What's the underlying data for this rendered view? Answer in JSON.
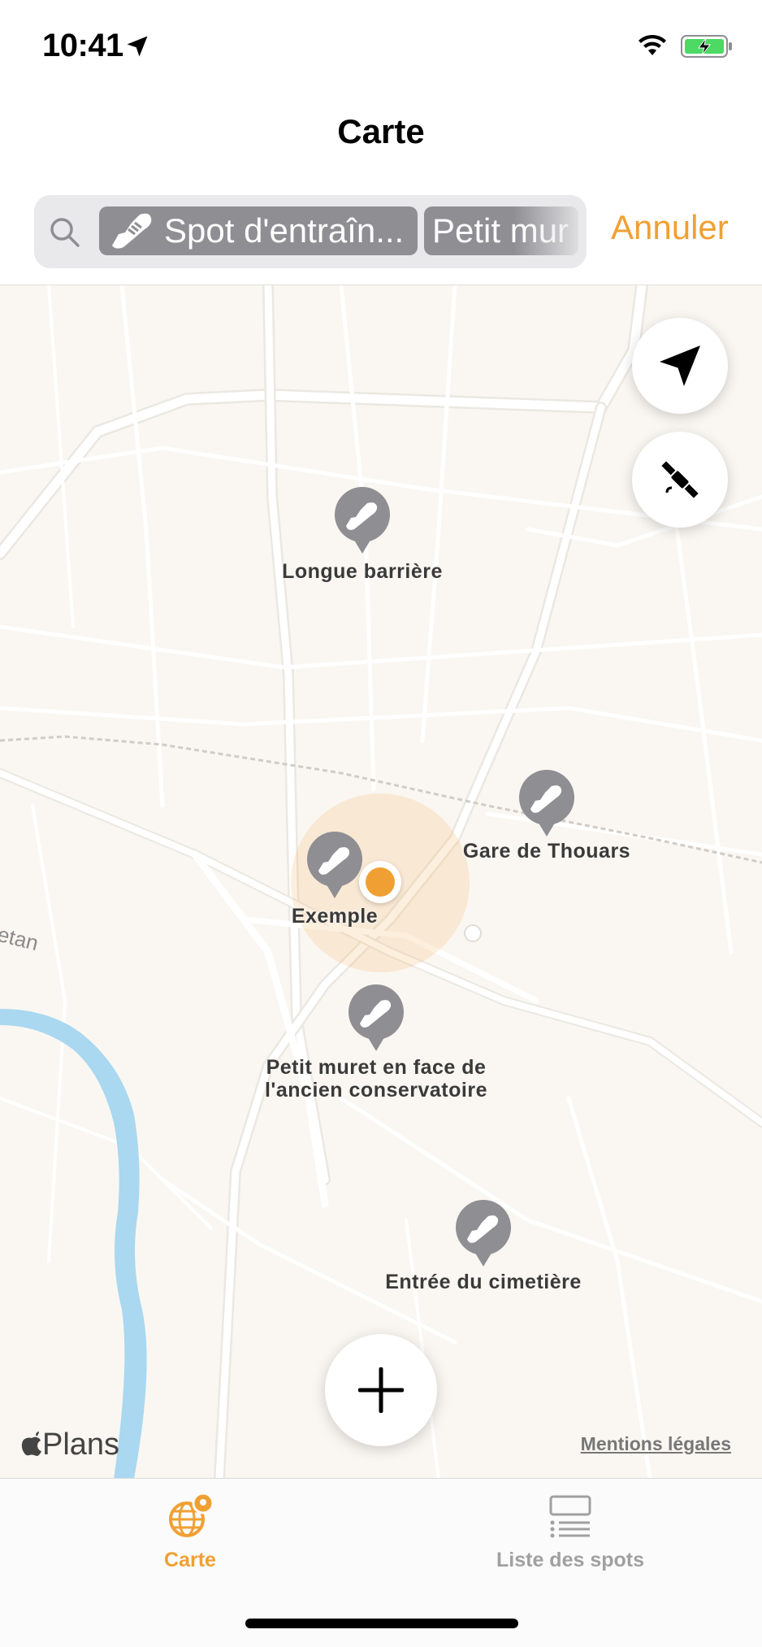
{
  "status_bar": {
    "time": "10:41",
    "icons": [
      "location-arrow-icon",
      "wifi-icon",
      "battery-charging-icon"
    ]
  },
  "nav": {
    "title": "Carte"
  },
  "search": {
    "tokens": [
      {
        "label": "Spot d'entraîn...",
        "icon": "shoe-icon"
      },
      {
        "label": "Petit mur"
      }
    ],
    "cancel_label": "Annuler"
  },
  "map": {
    "pins": [
      {
        "label": "Longue barrière"
      },
      {
        "label": "Gare de Thouars"
      },
      {
        "label": "Exemple"
      },
      {
        "label_line1": "Petit muret en face de",
        "label_line2": "l'ancien conservatoire"
      },
      {
        "label": "Entrée du cimetière"
      }
    ],
    "street_label": "lletan",
    "attribution": "Plans",
    "legal_label": "Mentions légales",
    "accent": "#f0a032"
  },
  "tabs": [
    {
      "label": "Carte",
      "icon": "globe-pin-icon",
      "selected": true
    },
    {
      "label": "Liste des spots",
      "icon": "list-icon",
      "selected": false
    }
  ]
}
